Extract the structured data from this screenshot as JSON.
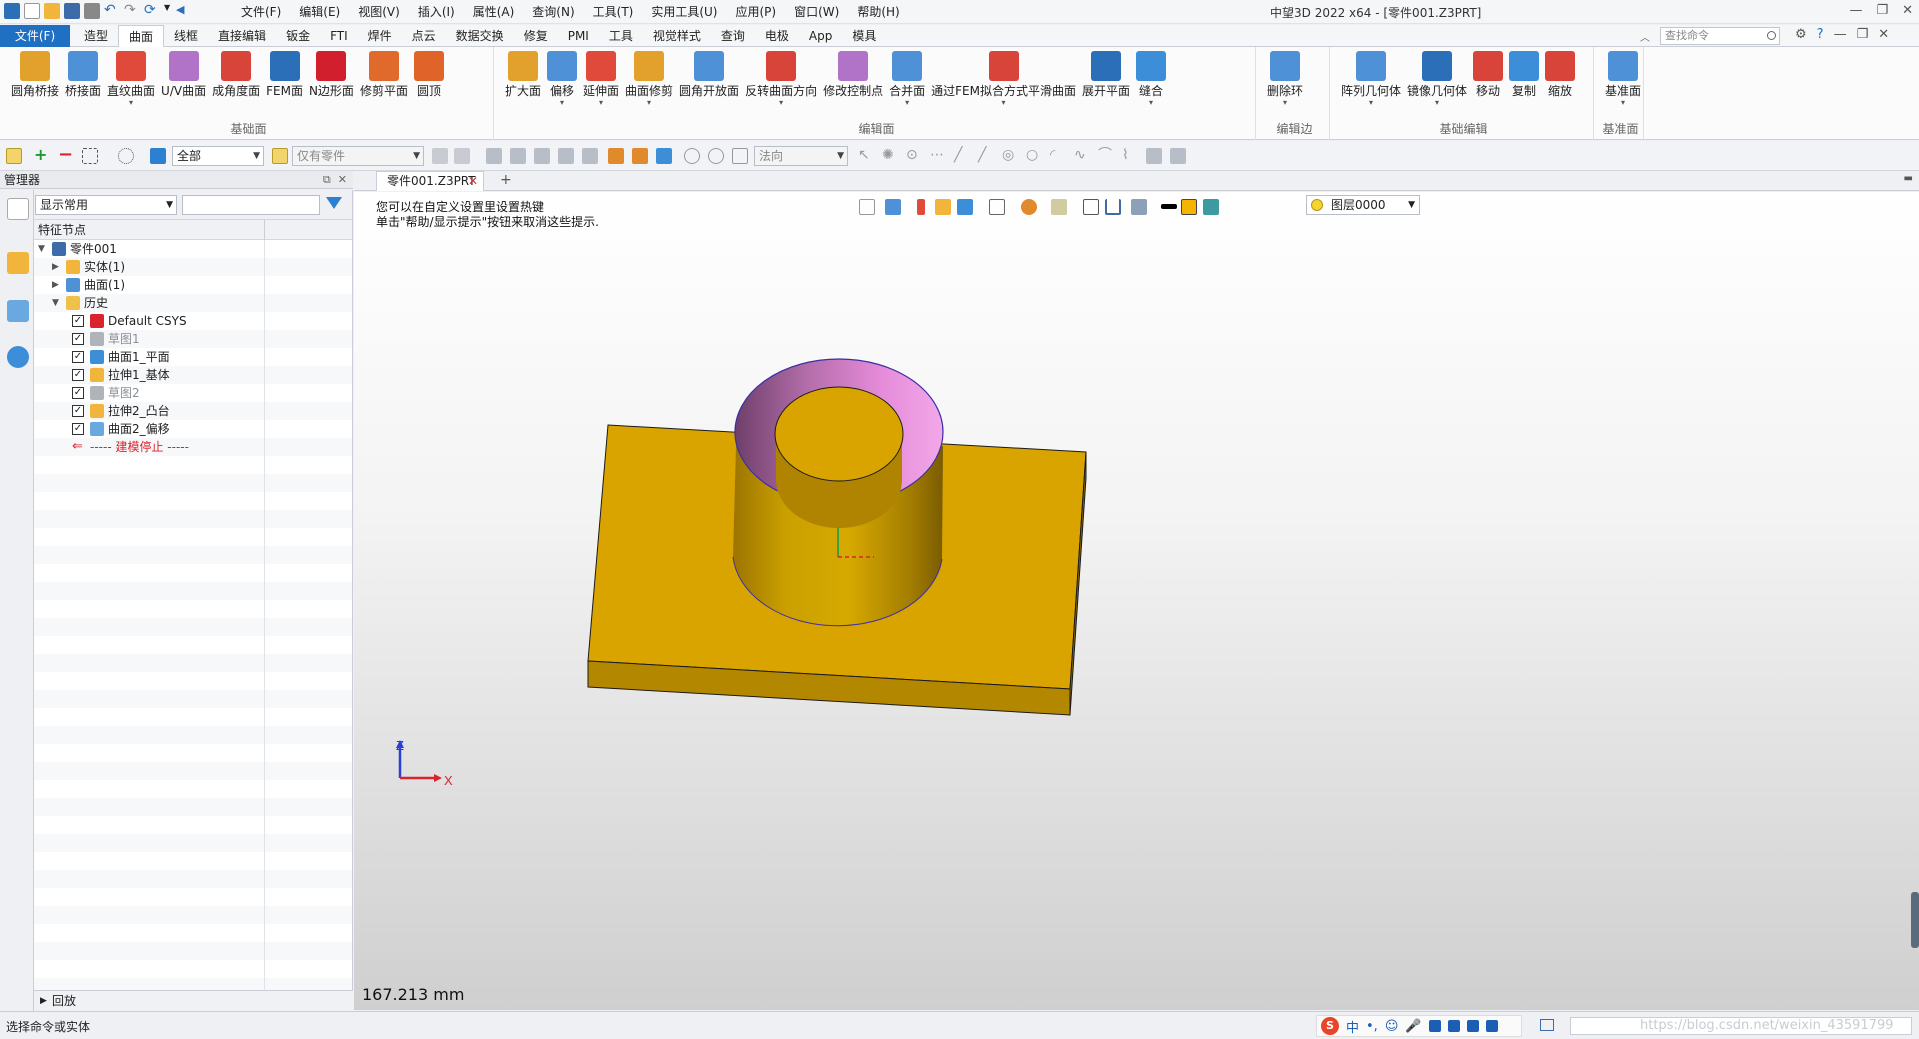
{
  "window": {
    "title": "中望3D 2022 x64 - [零件001.Z3PRT]",
    "menus": [
      "文件(F)",
      "编辑(E)",
      "视图(V)",
      "插入(I)",
      "属性(A)",
      "查询(N)",
      "工具(T)",
      "实用工具(U)",
      "应用(P)",
      "窗口(W)",
      "帮助(H)"
    ]
  },
  "ribbon_tabs": {
    "file": "文件(F)",
    "tabs": [
      "造型",
      "曲面",
      "线框",
      "直接编辑",
      "钣金",
      "FTI",
      "焊件",
      "点云",
      "数据交换",
      "修复",
      "PMI",
      "工具",
      "视觉样式",
      "查询",
      "电极",
      "App",
      "模具"
    ],
    "active": "曲面",
    "search_placeholder": "查找命令"
  },
  "ribbon": {
    "groups": [
      {
        "name": "基础面",
        "buttons": [
          "圆角桥接",
          "桥接面",
          "直纹曲面",
          "U/V曲面",
          "成角度面",
          "FEM面",
          "N边形面",
          "修剪平面",
          "圆顶"
        ],
        "dropdown": [
          false,
          false,
          true,
          false,
          false,
          false,
          false,
          false,
          false
        ],
        "colors": [
          "#e2a12c",
          "#4f91d6",
          "#e04a3a",
          "#b073c7",
          "#d8433a",
          "#2a6fb8",
          "#d21f2d",
          "#e06a2c",
          "#e0632a"
        ]
      },
      {
        "name": "编辑面",
        "buttons": [
          "扩大面",
          "偏移",
          "延伸面",
          "曲面修剪",
          "圆角开放面",
          "反转曲面方向",
          "修改控制点",
          "合并面",
          "通过FEM拟合方式平滑曲面",
          "展开平面",
          "缝合"
        ],
        "dropdown": [
          false,
          true,
          true,
          true,
          false,
          true,
          false,
          true,
          true,
          false,
          true
        ],
        "colors": [
          "#e2a12c",
          "#4f91d6",
          "#e04a3a",
          "#e2a12c",
          "#4f91d6",
          "#d8433a",
          "#b073c7",
          "#4f91d6",
          "#d8433a",
          "#2a6fb8",
          "#3d8ed9"
        ]
      },
      {
        "name": "编辑边",
        "buttons": [
          "删除环"
        ],
        "dropdown": [
          true
        ],
        "colors": [
          "#4f91d6"
        ]
      },
      {
        "name": "基础编辑",
        "buttons": [
          "阵列几何体",
          "镜像几何体",
          "移动",
          "复制",
          "缩放"
        ],
        "dropdown": [
          true,
          true,
          false,
          false,
          false
        ],
        "colors": [
          "#4f91d6",
          "#2a6fb8",
          "#d8433a",
          "#3d8ed9",
          "#d8433a"
        ]
      },
      {
        "name": "基准面",
        "buttons": [
          "基准面"
        ],
        "dropdown": [
          true
        ],
        "colors": [
          "#4f91d6"
        ]
      }
    ]
  },
  "toolbar": {
    "filter_value": "全部",
    "scope_value": "仅有零件",
    "direction_value": "法向"
  },
  "manager": {
    "title": "管理器",
    "display_combo": "显示常用",
    "column_header": "特征节点",
    "tree": [
      {
        "label": "零件001",
        "level": 0,
        "expander": "open",
        "check": false,
        "icon": "part-icon",
        "style": "normal"
      },
      {
        "label": "实体(1)",
        "level": 1,
        "expander": "closed",
        "check": false,
        "icon": "solid-icon",
        "style": "normal"
      },
      {
        "label": "曲面(1)",
        "level": 1,
        "expander": "closed",
        "check": false,
        "icon": "surface-icon",
        "style": "normal"
      },
      {
        "label": "历史",
        "level": 1,
        "expander": "open",
        "check": false,
        "icon": "folder-icon",
        "style": "normal"
      },
      {
        "label": "Default CSYS",
        "level": 2,
        "expander": "none",
        "check": true,
        "icon": "csys-icon",
        "style": "normal"
      },
      {
        "label": "草图1",
        "level": 2,
        "expander": "none",
        "check": true,
        "icon": "sketch-icon",
        "style": "grey"
      },
      {
        "label": "曲面1_平面",
        "level": 2,
        "expander": "none",
        "check": true,
        "icon": "plane-surface-icon",
        "style": "normal"
      },
      {
        "label": "拉伸1_基体",
        "level": 2,
        "expander": "none",
        "check": true,
        "icon": "extrude-icon",
        "style": "normal"
      },
      {
        "label": "草图2",
        "level": 2,
        "expander": "none",
        "check": true,
        "icon": "sketch-icon",
        "style": "grey"
      },
      {
        "label": "拉伸2_凸台",
        "level": 2,
        "expander": "none",
        "check": true,
        "icon": "extrude-icon",
        "style": "normal"
      },
      {
        "label": "曲面2_偏移",
        "level": 2,
        "expander": "none",
        "check": true,
        "icon": "offset-icon",
        "style": "normal"
      },
      {
        "label": "----- 建模停止 -----",
        "level": 2,
        "expander": "none",
        "check": false,
        "icon": "stop-arrow-icon",
        "style": "stop"
      }
    ],
    "footer": "回放"
  },
  "document": {
    "tab": "零件001.Z3PRT",
    "hint_line1": "您可以在自定义设置里设置热键",
    "hint_line2": "单击\"帮助/显示提示\"按钮来取消这些提示.",
    "layer": "图层0000",
    "measure": "167.213 mm",
    "axis_z": "Z",
    "axis_x": "X"
  },
  "colors": {
    "model_face": "#d9a400",
    "model_dark": "#a77d00",
    "inner_face": "#e58bd9",
    "accent": "#1f6fc2"
  },
  "status": {
    "text": "选择命令或实体",
    "ime_lang": "中",
    "watermark": "https://blog.csdn.net/weixin_43591799"
  }
}
